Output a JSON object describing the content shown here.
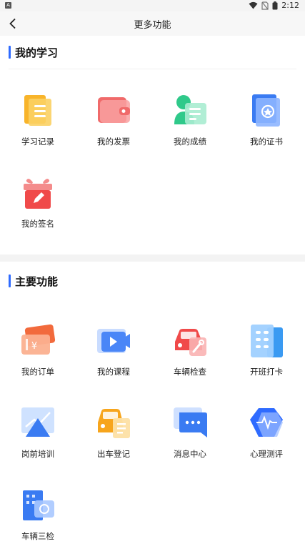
{
  "status_bar": {
    "app_badge": "A",
    "time": "2:12"
  },
  "nav": {
    "title": "更多功能"
  },
  "sections": {
    "study": {
      "title": "我的学习",
      "items": [
        {
          "label": "学习记录",
          "icon": "study-record-icon"
        },
        {
          "label": "我的发票",
          "icon": "invoice-wallet-icon"
        },
        {
          "label": "我的成绩",
          "icon": "grades-icon"
        },
        {
          "label": "我的证书",
          "icon": "certificate-icon"
        },
        {
          "label": "我的签名",
          "icon": "signature-gift-icon"
        }
      ]
    },
    "main": {
      "title": "主要功能",
      "items": [
        {
          "label": "我的订单",
          "icon": "order-ticket-icon"
        },
        {
          "label": "我的课程",
          "icon": "video-course-icon"
        },
        {
          "label": "车辆检查",
          "icon": "vehicle-inspection-icon"
        },
        {
          "label": "开班打卡",
          "icon": "class-checkin-icon"
        },
        {
          "label": "岗前培训",
          "icon": "pre-job-training-icon"
        },
        {
          "label": "出车登记",
          "icon": "departure-register-icon"
        },
        {
          "label": "消息中心",
          "icon": "message-center-icon"
        },
        {
          "label": "心理测评",
          "icon": "psych-assessment-icon"
        },
        {
          "label": "车辆三检",
          "icon": "vehicle-three-check-icon"
        }
      ]
    }
  },
  "colors": {
    "accent": "#2f6bff",
    "orange": "#f7a51c",
    "red": "#f04a4a",
    "green": "#2fc98a",
    "blue": "#3a7bf2"
  }
}
